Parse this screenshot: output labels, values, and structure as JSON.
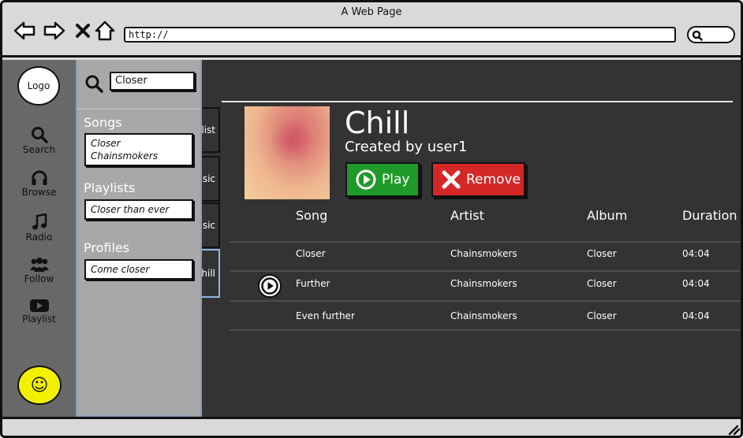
{
  "browser": {
    "window_title": "A Web Page",
    "url": "http://"
  },
  "rail": {
    "logo": "Logo",
    "items": [
      {
        "label": "Search",
        "icon": "search-icon"
      },
      {
        "label": "Browse",
        "icon": "headphones-icon"
      },
      {
        "label": "Radio",
        "icon": "music-note-icon"
      },
      {
        "label": "Follow",
        "icon": "users-icon"
      },
      {
        "label": "Playlist",
        "icon": "youtube-play-icon"
      }
    ],
    "profile_icon": "smiley-icon"
  },
  "search": {
    "query": "Closer",
    "songs_heading": "Songs",
    "song_result_title": "Closer",
    "song_result_artist": "Chainsmokers",
    "playlists_heading": "Playlists",
    "playlist_result": "Closer than ever",
    "profiles_heading": "Profiles",
    "profile_result": "Come closer"
  },
  "tabs_partial": [
    "list",
    "sic",
    "sic",
    "hill"
  ],
  "playlist": {
    "title": "Chill",
    "created_by": "Created by user1",
    "play_label": "Play",
    "remove_label": "Remove"
  },
  "table": {
    "headers": [
      "Song",
      "Artist",
      "Album",
      "Duration"
    ],
    "rows": [
      {
        "song": "Closer",
        "artist": "Chainsmokers",
        "album": "Closer",
        "duration": "04:04"
      },
      {
        "song": "Further",
        "artist": "Chainsmokers",
        "album": "Closer",
        "duration": "04:04"
      },
      {
        "song": "Even further",
        "artist": "Chainsmokers",
        "album": "Closer",
        "duration": "04:04"
      }
    ]
  },
  "colors": {
    "play": "#1f9a2a",
    "remove": "#d42828",
    "app_bg": "#333333",
    "search_panel": "#a8a8a8",
    "smiley": "#f2f200"
  }
}
